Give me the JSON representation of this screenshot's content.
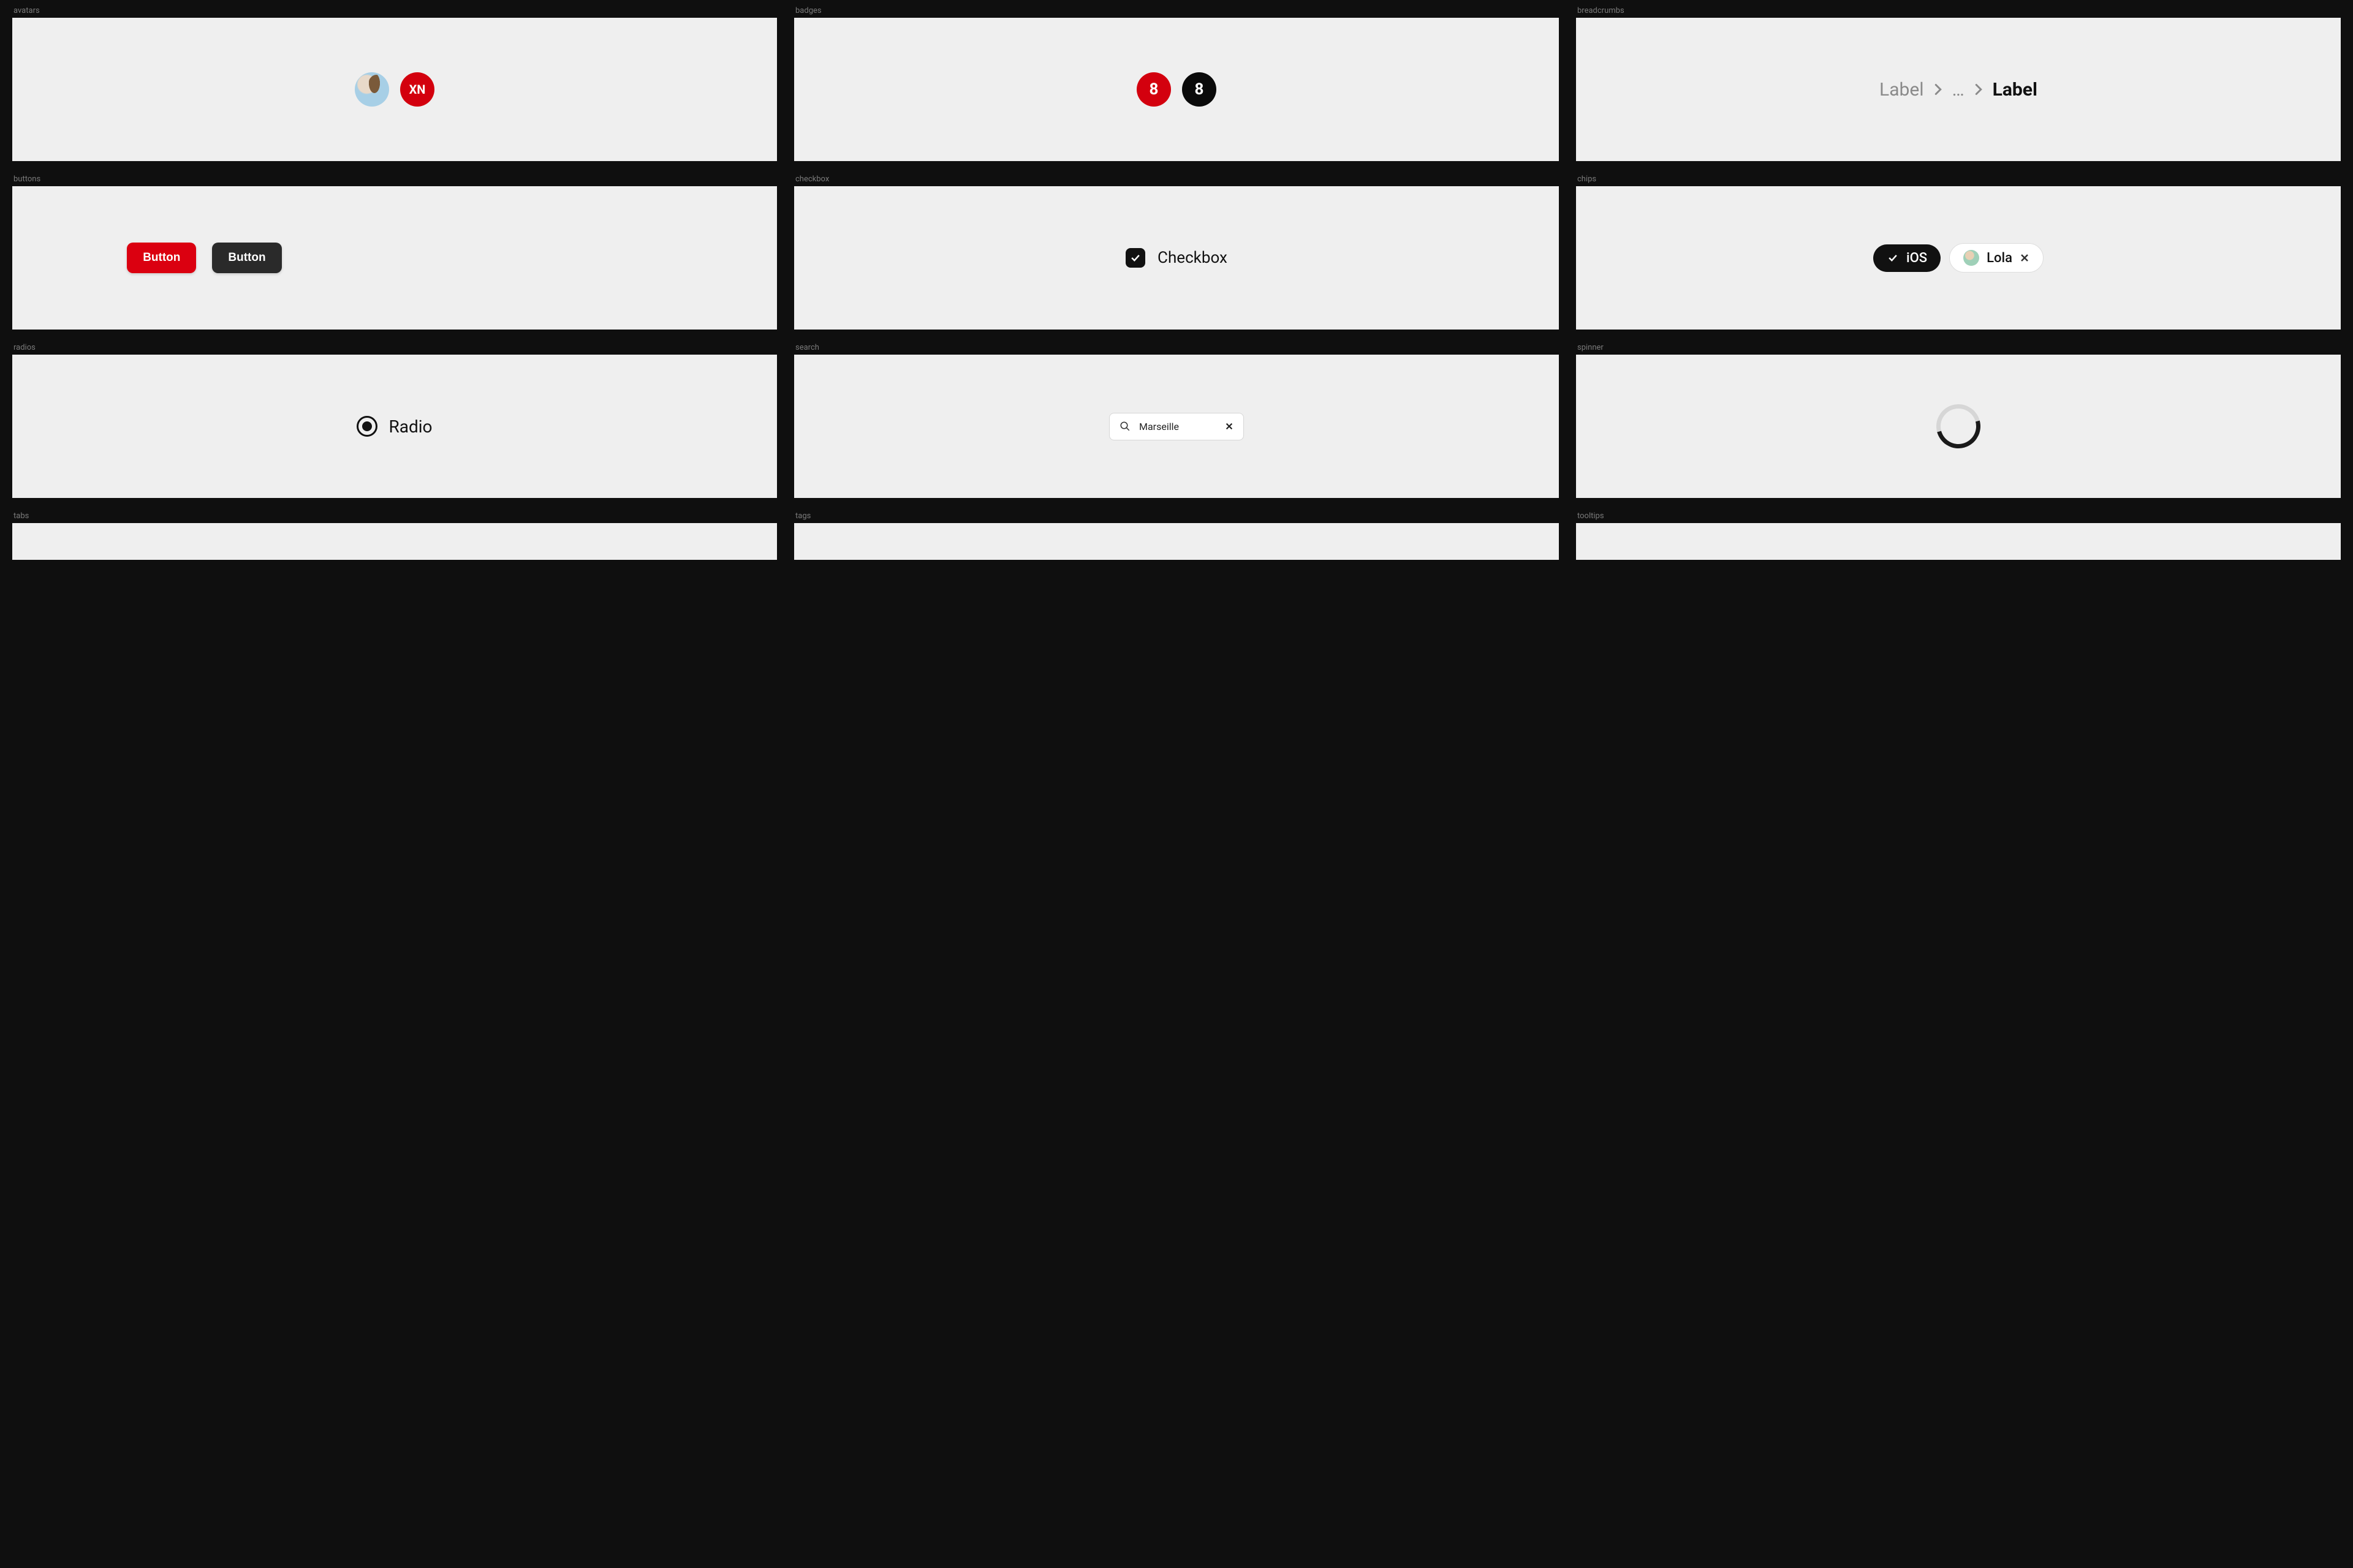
{
  "sections": {
    "avatars": {
      "title": "avatars",
      "initials": "XN"
    },
    "badges": {
      "title": "badges",
      "red_value": "8",
      "black_value": "8"
    },
    "breadcrumbs": {
      "title": "breadcrumbs",
      "first": "Label",
      "ellipsis": "…",
      "last": "Label"
    },
    "buttons": {
      "title": "buttons",
      "primary": "Button",
      "secondary": "Button"
    },
    "checkbox": {
      "title": "checkbox",
      "label": "Checkbox"
    },
    "chips": {
      "title": "chips",
      "chip1": "iOS",
      "chip2": "Lola"
    },
    "radios": {
      "title": "radios",
      "label": "Radio"
    },
    "search": {
      "title": "search",
      "value": "Marseille"
    },
    "spinner": {
      "title": "spinner"
    },
    "tabs": {
      "title": "tabs"
    },
    "tags": {
      "title": "tags"
    },
    "tooltips": {
      "title": "tooltips"
    }
  },
  "colors": {
    "red": "#d3000e",
    "black": "#0a0a0a",
    "panel": "#efefef",
    "bg": "#0f0f0f"
  }
}
